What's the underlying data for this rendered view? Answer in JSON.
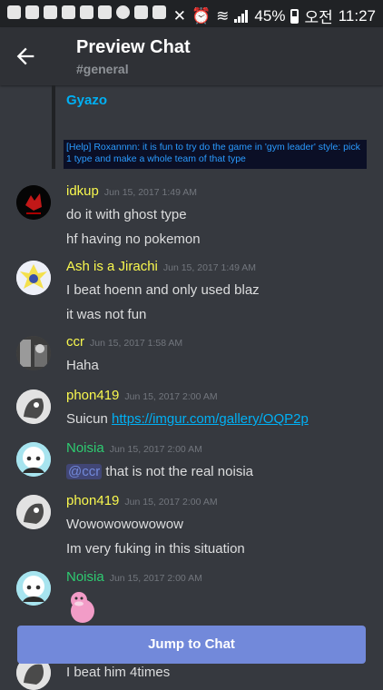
{
  "status_bar": {
    "battery": "45%",
    "lang": "오전",
    "time": "11:27"
  },
  "header": {
    "title": "Preview Chat",
    "channel": "#general"
  },
  "embed": {
    "provider": "Gyazo",
    "image_text": "[Help] Roxannnn: it is fun to try do the game in 'gym leader' style: pick 1 type and make a whole team of that type"
  },
  "messages": [
    {
      "author": "idkup",
      "color": "#f9f84e",
      "time": "Jun 15, 2017 1:49 AM",
      "lines": [
        "do it with ghost type",
        "hf having no pokemon"
      ]
    },
    {
      "author": "Ash is a Jirachi",
      "color": "#f9f84e",
      "time": "Jun 15, 2017 1:49 AM",
      "lines": [
        "I beat hoenn and only used blaz",
        "it was not fun"
      ]
    },
    {
      "author": "ccr",
      "color": "#f9f84e",
      "time": "Jun 15, 2017 1:58 AM",
      "lines": [
        "Haha"
      ]
    },
    {
      "author": "phon419",
      "color": "#f9f84e",
      "time": "Jun 15, 2017 2:00 AM",
      "prefix": "Suicun ",
      "link": "https://imgur.com/gallery/OQP2p"
    },
    {
      "author": "Noisia",
      "color": "#2ecc71",
      "time": "Jun 15, 2017 2:00 AM",
      "mention": "@ccr",
      "text": " that is not the real noisia"
    },
    {
      "author": "phon419",
      "color": "#f9f84e",
      "time": "Jun 15, 2017 2:00 AM",
      "lines": [
        "Wowowowowowow",
        "Im very fuking in this situation"
      ]
    },
    {
      "author": "Noisia",
      "color": "#2ecc71",
      "time": "Jun 15, 2017 2:00 AM",
      "sticker": "pink-slowpoke-sticker"
    }
  ],
  "bottom_partial_line": "I beat him 4times",
  "jump_button": "Jump to Chat",
  "colors": {
    "background": "#36393f",
    "header": "#2f3136",
    "accent": "#7289da",
    "link": "#00b0f4"
  }
}
